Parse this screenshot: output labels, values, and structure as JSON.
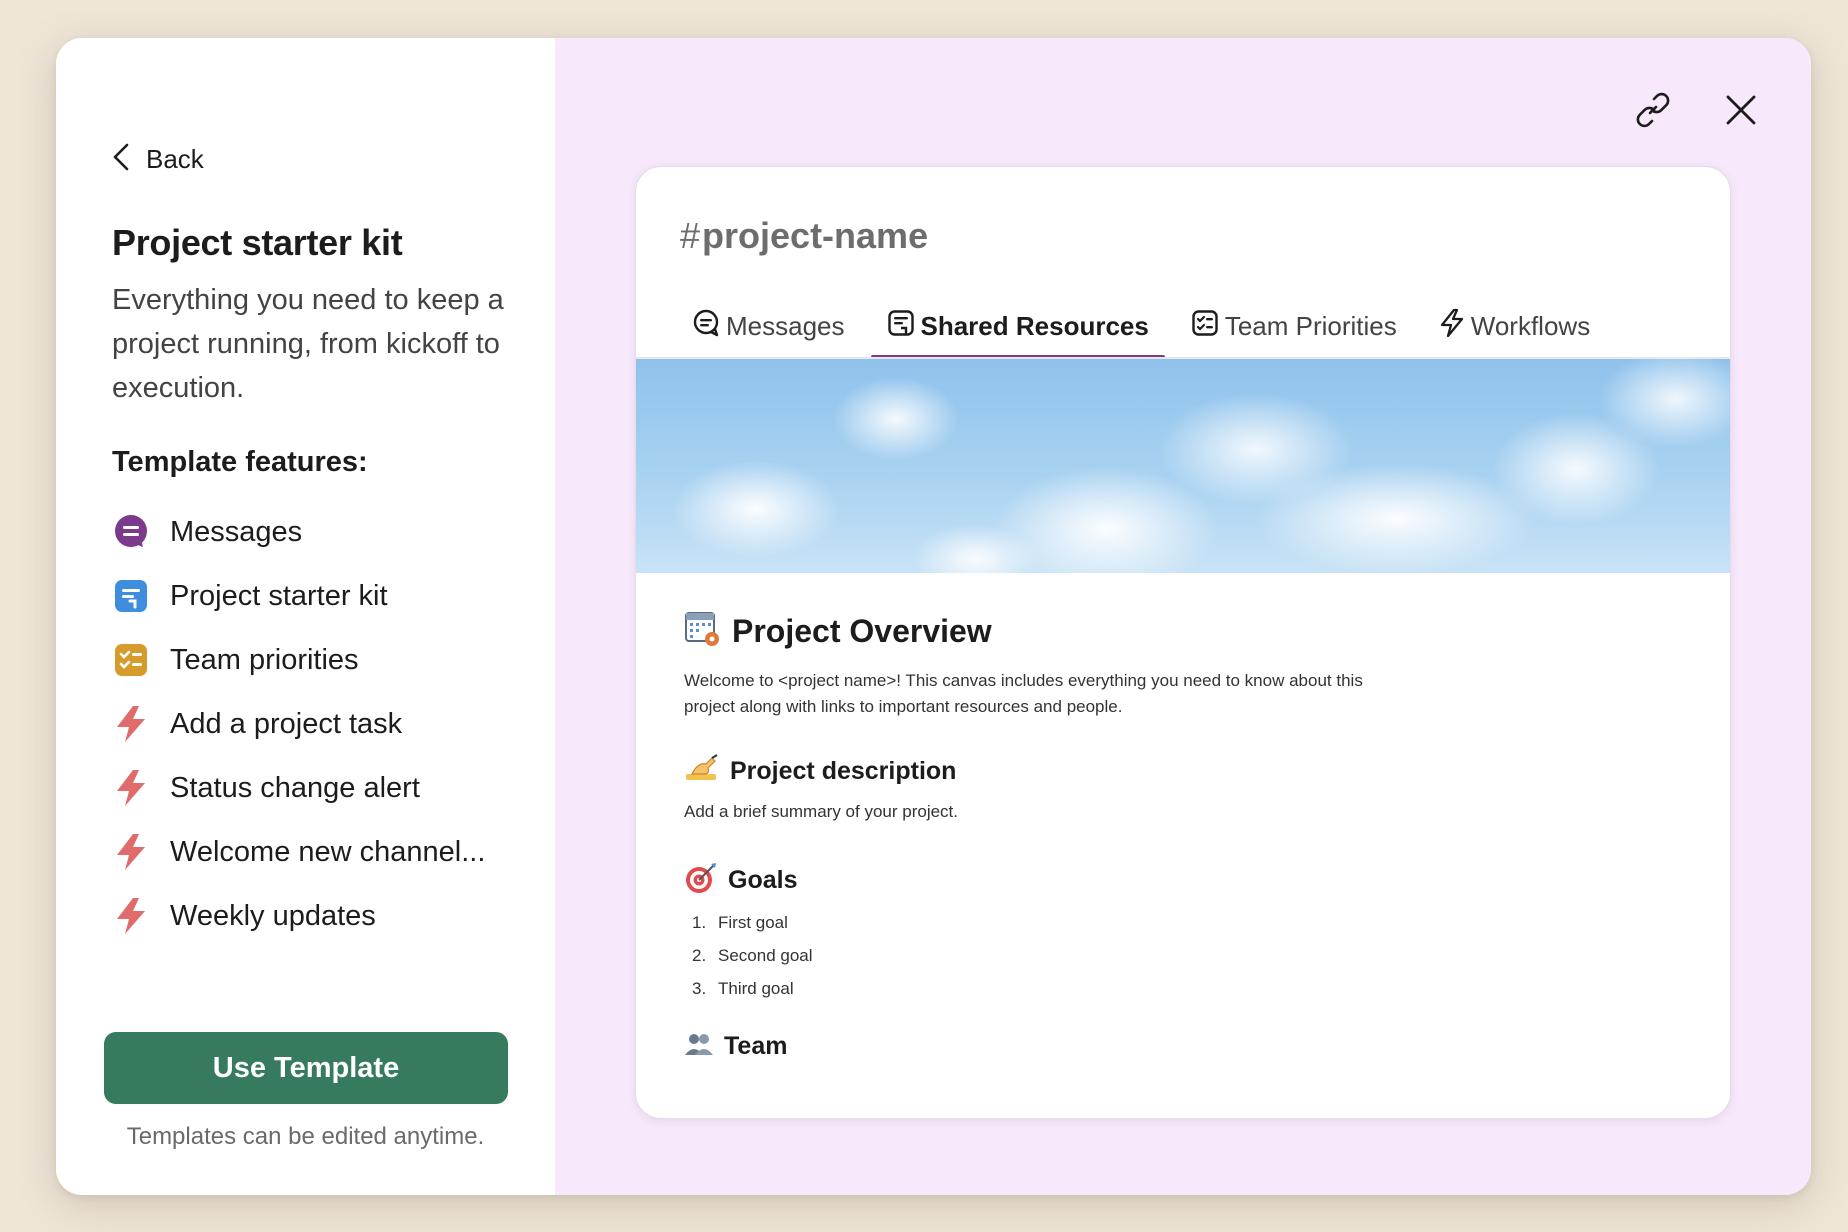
{
  "left": {
    "back_label": "Back",
    "title": "Project starter kit",
    "description": "Everything you need to keep a project running, from kickoff to execution.",
    "features_heading": "Template features:",
    "features": [
      {
        "label": "Messages",
        "icon": "messages-icon"
      },
      {
        "label": "Project starter kit",
        "icon": "canvas-icon"
      },
      {
        "label": "Team priorities",
        "icon": "list-icon"
      },
      {
        "label": "Add a project task",
        "icon": "workflow-bolt-icon"
      },
      {
        "label": "Status change alert",
        "icon": "workflow-bolt-icon"
      },
      {
        "label": "Welcome new channel...",
        "icon": "workflow-bolt-icon"
      },
      {
        "label": "Weekly updates",
        "icon": "workflow-bolt-icon"
      }
    ],
    "use_template_label": "Use Template",
    "hint": "Templates can be edited anytime."
  },
  "preview": {
    "channel_hash": "#",
    "channel_name": "project-name",
    "tabs": [
      {
        "label": "Messages",
        "active": false
      },
      {
        "label": "Shared Resources",
        "active": true
      },
      {
        "label": "Team Priorities",
        "active": false
      },
      {
        "label": "Workflows",
        "active": false
      }
    ],
    "overview_title": "Project Overview",
    "overview_text": "Welcome to <project name>! This canvas includes everything you need to know about this project along with links to important resources and people.",
    "description_title": "Project description",
    "description_text": "Add a brief summary of your project.",
    "goals_title": "Goals",
    "goals": [
      {
        "num": "1.",
        "text": "First goal"
      },
      {
        "num": "2.",
        "text": "Second goal"
      },
      {
        "num": "3.",
        "text": "Third goal"
      }
    ],
    "team_title": "Team"
  },
  "colors": {
    "accent_purple": "#7c3a8c",
    "button_green": "#367b5d",
    "panel_lilac": "#f7e9fb",
    "backdrop": "#efe6d8",
    "bolt_red": "#e06b6b"
  }
}
